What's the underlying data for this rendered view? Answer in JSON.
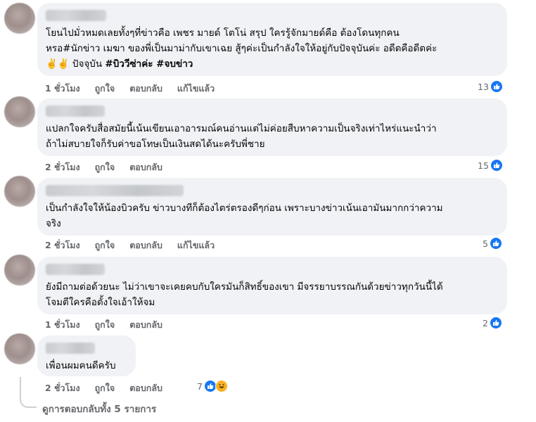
{
  "comments": [
    {
      "text_lines": [
        "โยนไปมั่วหมดเลยทั้งๆที่ข่าวคือ เพชร มายด์ โตโน่ สรุป ใครรู้จักมายด์คือ ต้องโดนทุกคน",
        "หรอ#นักข่าว เมฆา ของพี่เป็นมาม่ากับเขาเฉย สู้ๆค่ะเป็นกำลังใจให้อยู่กับปัจจุบันค่ะ อดีตคือดีตค่ะ"
      ],
      "last_line_prefix": "✌️✌️ ปัจจุบัน",
      "last_line_bold": "#บิววีซ่าค่ะ #จบข่าว",
      "time": "1 ชั่วโมง",
      "like": "ถูกใจ",
      "reply": "ตอบกลับ",
      "edited": "แก้ไขแล้ว",
      "reaction_count": "13"
    },
    {
      "text_lines": [
        "แปลกใจครับสื่อสมัยนี้เน้นเขียนเอาอารมณ์คนอ่านแต่ไม่ค่อยสืบหาความเป็นจริงเท่าไหร่แนะนำว่า",
        "ถ้าไม่สบายใจก็รับค่าขอโทษเป็นเงินสดได้นะครับพี่ชาย"
      ],
      "time": "2 ชั่วโมง",
      "like": "ถูกใจ",
      "reply": "ตอบกลับ",
      "reaction_count": "15"
    },
    {
      "text_lines": [
        "เป็นกำลังใจให้น้องบิวครับ ข่าวบางทีก็ต้องไตร่ตรองดีๆก่อน เพราะบางข่าวเน้นเอามันมากกว่าความ",
        "จริง"
      ],
      "time": "2 ชั่วโมง",
      "like": "ถูกใจ",
      "reply": "ตอบกลับ",
      "edited": "แก้ไขแล้ว",
      "reaction_count": "5"
    },
    {
      "text_lines": [
        "ยังมีถามต่อด้วยนะ ไม่ว่าเขาจะเคยคบกับใครมันก็สิทธิ์ของเขา มีจรรยาบรรณกันด้วยข่าวทุกวันนี้ได้",
        "โจมตีใครคือตั้งใจเอ้าให้จม"
      ],
      "time": "1 ชั่วโมง",
      "like": "ถูกใจ",
      "reply": "ตอบกลับ",
      "reaction_count": "2"
    },
    {
      "text_lines": [
        "เพื่อนผมคนดีครับ"
      ],
      "time": "2 ชั่วโมง",
      "like": "ถูกใจ",
      "reply": "ตอบกลับ",
      "reaction_count": "7"
    }
  ],
  "view_more_replies": "ดูการตอบกลับทั้ง 5 รายการ",
  "colors": {
    "bubble": "#f0f2f5",
    "like_blue": "#1877f2",
    "meta_gray": "#65676b",
    "haha_yellow": "#f7b125"
  },
  "icons": {
    "like": "thumbs-up-icon",
    "haha": "haha-emoji-icon"
  }
}
